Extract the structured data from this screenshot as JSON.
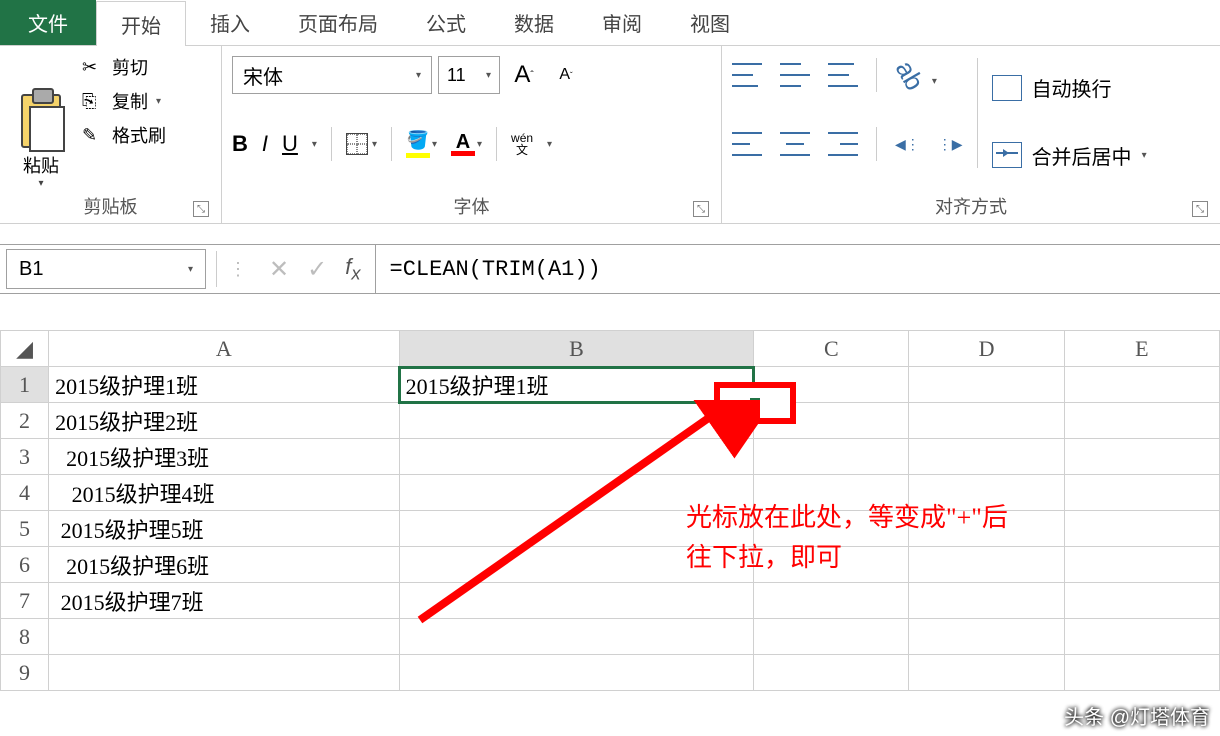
{
  "tabs": {
    "file": "文件",
    "home": "开始",
    "insert": "插入",
    "layout": "页面布局",
    "formula": "公式",
    "data": "数据",
    "review": "审阅",
    "view": "视图"
  },
  "clipboard": {
    "paste": "粘贴",
    "cut": "剪切",
    "copy": "复制",
    "format_painter": "格式刷",
    "group_label": "剪贴板"
  },
  "font": {
    "name": "宋体",
    "size": "11",
    "increase": "A",
    "decrease": "A",
    "bold": "B",
    "italic": "I",
    "underline": "U",
    "phonetic_top": "wén",
    "phonetic_bot": "文",
    "group_label": "字体"
  },
  "alignment": {
    "wrap": "自动换行",
    "merge": "合并后居中",
    "group_label": "对齐方式"
  },
  "formula_bar": {
    "cell_ref": "B1",
    "formula": "=CLEAN(TRIM(A1))"
  },
  "columns": [
    "A",
    "B",
    "C",
    "D",
    "E"
  ],
  "rows": [
    {
      "n": "1",
      "A": "2015级护理1班",
      "B": "2015级护理1班"
    },
    {
      "n": "2",
      "A": "2015级护理2班",
      "B": ""
    },
    {
      "n": "3",
      "A": "  2015级护理3班",
      "B": ""
    },
    {
      "n": "4",
      "A": "   2015级护理4班",
      "B": ""
    },
    {
      "n": "5",
      "A": " 2015级护理5班",
      "B": ""
    },
    {
      "n": "6",
      "A": "  2015级护理6班",
      "B": ""
    },
    {
      "n": "7",
      "A": " 2015级护理7班",
      "B": ""
    },
    {
      "n": "8",
      "A": "",
      "B": ""
    },
    {
      "n": "9",
      "A": "",
      "B": ""
    }
  ],
  "annotation": {
    "line1": "光标放在此处，等变成\"+\"后",
    "line2": "往下拉，即可"
  },
  "watermark": "头条 @灯塔体育"
}
